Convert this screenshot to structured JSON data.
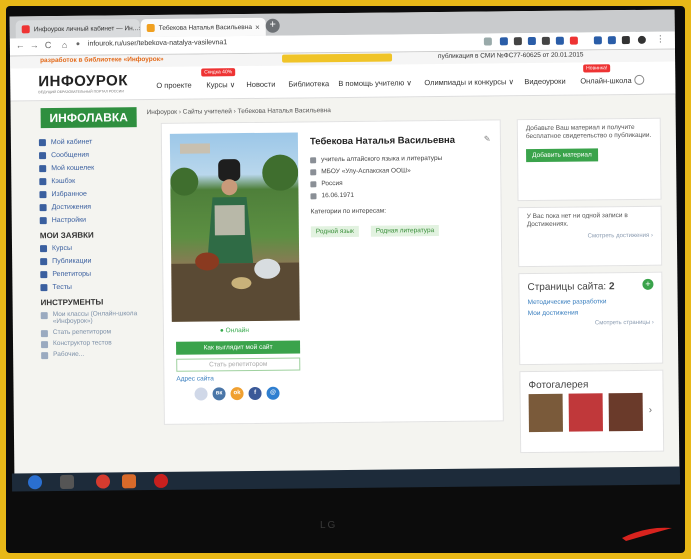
{
  "browser": {
    "tabs": [
      {
        "label": "Инфоурок личный кабинет — Ин..."
      },
      {
        "label": "Тебекова Наталья Васильевна"
      }
    ],
    "url": "infourok.ru/user/tebekova-natalya-vasilevna1"
  },
  "site": {
    "top_promo": "разработок в библиотеке «Инфоурок»",
    "pub_info": "публикация в СМИ №ФС77-60625 от 20.01.2015",
    "logo": "ИНФОУРОК",
    "logo_sub": "ВЕДУЩИЙ ОБРАЗОВАТЕЛЬНЫЙ ПОРТАЛ РОССИИ",
    "sale_badge": "Скидка 40%",
    "new_badge": "Новинка!",
    "menu": [
      "О проекте",
      "Курсы ∨",
      "Новости",
      "Библиотека",
      "В помощь учителю ∨",
      "Олимпиады и конкурсы ∨",
      "Видеоуроки",
      "Онлайн-школа"
    ],
    "lavka": "ИНФОЛАВКА",
    "breadcrumb": "Инфоурок › Сайты учителей › Тебекова Наталья Васильевна"
  },
  "sidebar": {
    "items": [
      "Мой кабинет",
      "Сообщения",
      "Мой кошелек",
      "Кэшбэк",
      "Избранное",
      "Достижения",
      "Настройки"
    ],
    "heading1": "МОИ ЗАЯВКИ",
    "items2": [
      "Курсы",
      "Публикации",
      "Репетиторы",
      "Тесты"
    ],
    "heading2": "ИНСТРУМЕНТЫ",
    "tools": [
      "Мои классы (Онлайн-школа «Инфоурок»)",
      "Стать репетитором",
      "Конструктор тестов",
      "Рабочие..."
    ]
  },
  "profile": {
    "name": "Тебекова Наталья Васильевна",
    "position": "учитель алтайского языка и литературы",
    "school": "МБОУ «Улу-Аспакская ООШ»",
    "country": "Россия",
    "date": "16.06.1971",
    "interests_label": "Категории по интересам:",
    "tags": [
      "Родной язык",
      "Родная литература"
    ],
    "online": "● Онлайн",
    "btn_site": "Как выглядит мой сайт",
    "btn_tutor": "Стать репетитором",
    "address_label": "Адрес сайта"
  },
  "right": {
    "add_text": "Добавьте Ваш материал и получите бесплатное свидетельство о публикации.",
    "add_button": "Добавить материал",
    "ach_text": "У Вас пока нет ни одной записи в Достижениях.",
    "ach_link": "Смотреть достижения ›",
    "pages_title": "Страницы сайта:",
    "pages_count": "2",
    "pages_links": [
      "Методические разработки",
      "Мои достижения"
    ],
    "pages_link_all": "Смотреть страницы ›",
    "gallery_title": "Фотогалерея"
  },
  "bezel": {
    "brand": "LG"
  }
}
